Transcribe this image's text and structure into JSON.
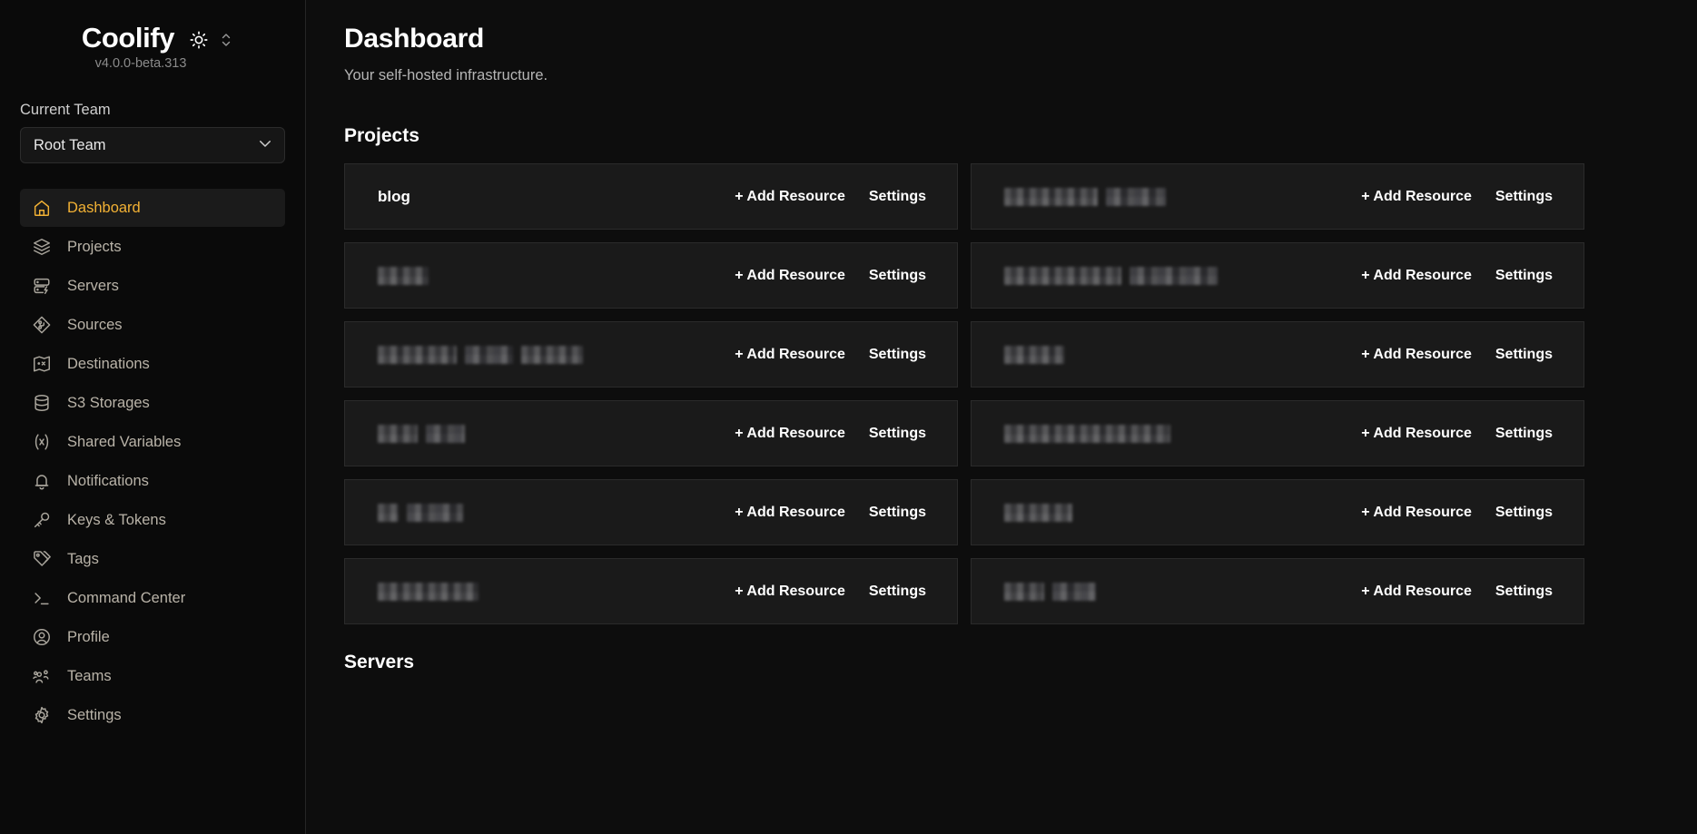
{
  "sidebar": {
    "brand": "Coolify",
    "version": "v4.0.0-beta.313",
    "theme_toggle_icon": "sun-icon",
    "theme_chevron_icon": "chevron-up-down-icon",
    "current_team_label": "Current Team",
    "current_team_value": "Root Team",
    "team_chevron_icon": "chevron-down-icon",
    "active_color": "#f2b134",
    "items": [
      {
        "label": "Dashboard",
        "icon": "home-icon",
        "active": true
      },
      {
        "label": "Projects",
        "icon": "layers-icon",
        "active": false
      },
      {
        "label": "Servers",
        "icon": "server-bolt-icon",
        "active": false
      },
      {
        "label": "Sources",
        "icon": "git-source-icon",
        "active": false
      },
      {
        "label": "Destinations",
        "icon": "map-pin-icon",
        "active": false
      },
      {
        "label": "S3 Storages",
        "icon": "database-icon",
        "active": false
      },
      {
        "label": "Shared Variables",
        "icon": "variable-icon",
        "active": false
      },
      {
        "label": "Notifications",
        "icon": "bell-icon",
        "active": false
      },
      {
        "label": "Keys & Tokens",
        "icon": "key-icon",
        "active": false
      },
      {
        "label": "Tags",
        "icon": "tags-icon",
        "active": false
      },
      {
        "label": "Command Center",
        "icon": "terminal-icon",
        "active": false
      },
      {
        "label": "Profile",
        "icon": "user-circle-icon",
        "active": false
      },
      {
        "label": "Teams",
        "icon": "users-icon",
        "active": false
      },
      {
        "label": "Settings",
        "icon": "gear-icon",
        "active": false
      }
    ]
  },
  "main": {
    "title": "Dashboard",
    "subtitle": "Your self-hosted infrastructure.",
    "projects_section_title": "Projects",
    "servers_section_title": "Servers",
    "add_resource_label": "+ Add Resource",
    "settings_label": "Settings",
    "projects": [
      {
        "name": "blog",
        "redacted": false,
        "redacted_widths": []
      },
      {
        "name": "",
        "redacted": true,
        "redacted_widths": [
          103,
          66
        ]
      },
      {
        "name": "",
        "redacted": true,
        "redacted_widths": [
          56
        ]
      },
      {
        "name": "",
        "redacted": true,
        "redacted_widths": [
          129,
          97
        ]
      },
      {
        "name": "",
        "redacted": true,
        "redacted_widths": [
          87,
          53,
          68
        ]
      },
      {
        "name": "",
        "redacted": true,
        "redacted_widths": [
          66
        ]
      },
      {
        "name": "",
        "redacted": true,
        "redacted_widths": [
          44,
          43
        ]
      },
      {
        "name": "",
        "redacted": true,
        "redacted_widths": [
          183
        ]
      },
      {
        "name": "",
        "redacted": true,
        "redacted_widths": [
          23,
          62
        ]
      },
      {
        "name": "",
        "redacted": true,
        "redacted_widths": [
          75
        ]
      },
      {
        "name": "",
        "redacted": true,
        "redacted_widths": [
          111
        ]
      },
      {
        "name": "",
        "redacted": true,
        "redacted_widths": [
          44,
          48
        ]
      }
    ]
  }
}
